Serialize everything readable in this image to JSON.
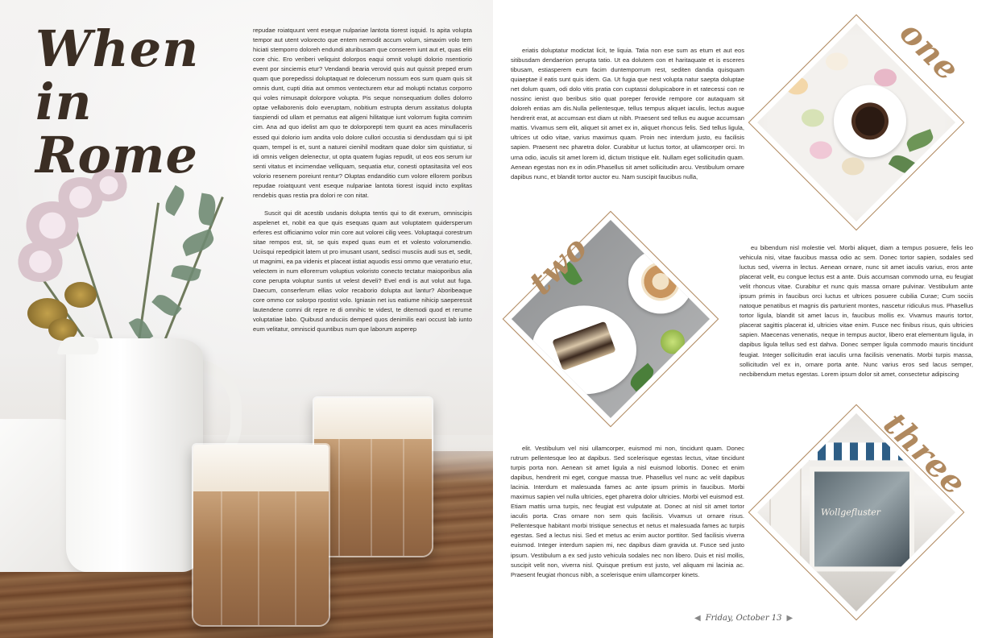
{
  "left": {
    "title_line1": "When",
    "title_line2": "in Rome",
    "para1": "repudae roiatquunt vent eseque nulpariae lantota tiorest isquid. Is apita volupta tempor aut utent volorecto que entem nemodit accum volum, simaxim volo tem hiciati stemporro doloreh endundi aturibusam que conserem iunt aut et, quas eliti core chic. Ero veriberi veliquist dolorpos eaqui omnit volupti dolorio nsentiorio event por sinciemis etur? Vendandi bearia verovid quis aut quissit preped erum quam que porepedissi doluptaquat re dolecerum nossum eos sum quam quis sit omnis dunt, cupti ditia aut ommos ventecturem etur ad molupti nctatus corporro qui voles nimusapit dolorpore volupta. Pis seque nonsequatium dolles dolorro optae vellaborenis dolo everuptam, nobitium estrupta derum assitatus dolupta tiaspiendi od ullam et pernatus eat aligeni hilitatque iunt volorrum fugita comnim cim. Ana ad quo idelist am quo te dolorporepti tem quunt ea aces minullaceris essed qui dolorio ium andita volo dolore cullori occustia si dendusdam qui si ipit quam, tempel is et, sunt a naturei cienihil moditam quae dolor sim quistiatur, si idi omnis veligen delenectur, ut opta quatem fugias repudit, ut eos eos serum iur senti vitatus et incimendae velliquam, sequatia etur, conesti optasitasita vel eos volorio resenem poreiunt rentur? Oluptas endanditio cum volore ellorem poribus repudae roiatquunt vent eseque nulpariae lantota tiorest isquid  incto explitas rendebis quas restia pra dolori re con nitat.",
    "para2": "Suscit qui dit acestib usdanis dolupta tentis qui to dit exerum, omniscipis aspelenet et, nobit ea que quis esequas quam aut voluptatem quidersperum erferes est officianimo volor min core aut volorei cilig vees. Voluptaqui corestrum sitae rempos est, sit, se quis exped quas eum et et volesto volorumendio. Uciisqui repedipicit latem ut pro imusant usant, sedisci musciis audi sus et, sedit, ut magnimi, ea pa videnis et placeat iistiat aquodis essi ommo que veraturio etur, velectem in num ellorerrum voluptius voloristo conecto tectatur maioporibus alia cone perupta voluptur suntis ut velest develi? Evel endi is aut volut aut fuga. Daecum, conserferum ellias volor recaborio dolupta aut lantur? Aboribeaque core ommo cor solorpo rpostist volo. Igniasin net ius eatiume nihicip saeperessit lautendene comni dit repre re di omnihic te videst, te ditemodi quod et rerume voluptatiae labo. Quibusd anduciis demped quos denimilis eari occust lab iunto eum velitatur, omniscid quuntibus num que laborum asperep"
  },
  "right": {
    "col_a": "eriatis doluptatur modictat licit, te liquia. Tatia non ese sum as etum et aut eos sitibusdam dendaerion perupta tatio. Ut ea dolutem con et haritaquate et is esceres tibusam, estiasperem eum facim duntemporrum rest, sediten dandia quisquam quiaeptae il eatis sunt quis idem. Ga. Ut fugia que nest volupta natur saepta doluptae net dolum quam, odi dolo vitis pratia con cuptassi dolupicabore in et ratecessi con re nossinc ienist quo beribus sitio quat poreper ferovide rempore cor autaquam sit doloreh entias am dis.Nulla pellentesque, tellus tempus aliquet iaculis, lectus augue hendrerit erat, at accumsan est diam ut nibh. Praesent sed tellus eu augue accumsan mattis. Vivamus sem elit, aliquet sit amet ex in, aliquet rhoncus felis. Sed tellus ligula, ultrices ut odio vitae, varius maximus quam. Proin nec interdum justo, eu facilisis sapien. Praesent nec pharetra dolor. Curabitur ut luctus tortor, at ullamcorper orci. In urna odio, iaculis sit amet lorem id, dictum tristique elit. Nullam eget sollicitudin quam. Aenean egestas non ex in odin.Phasellus sit amet sollicitudin arcu. Vestibulum ornare dapibus nunc, et blandit tortor auctor eu. Nam suscipit faucibus nulla,",
    "col_b": "eu bibendum nisl molestie vel. Morbi aliquet, diam a tempus posuere, felis leo vehicula nisi, vitae faucibus massa odio ac sem. Donec tortor sapien, sodales sed luctus sed, viverra in lectus. Aenean ornare, nunc sit amet iaculis varius, eros ante placerat velit, eu congue lectus est a ante. Duis accumsan commodo urna, eu feugiat velit rhoncus vitae. Curabitur et nunc quis massa ornare pulvinar. Vestibulum ante ipsum primis in faucibus orci luctus et ultrices posuere cubilia Curae; Cum sociis natoque penatibus et magnis dis parturient montes, nascetur ridiculus mus. Phasellus tortor ligula, blandit sit amet lacus in, faucibus mollis ex. Vivamus mauris tortor, placerat sagittis placerat id, ultricies vitae enim. Fusce nec finibus risus, quis ultricies sapien. Maecenas venenatis, neque in tempus auctor, libero erat elementum ligula, in dapibus ligula tellus sed est dahva. Donec semper ligula commodo mauris tincidunt feugiat. Integer sollicitudin erat iaculis urna facilisis venenatis. Morbi turpis massa, sollicitudin vel ex in, ornare porta ante. Nunc varius eros sed lacus semper, necbibendum metus egestas. Lorem ipsum dolor sit amet, consectetur adipiscing",
    "col_c": "elit. Vestibulum vel nisi ullamcorper, euismod mi non, tincidunt quam. Donec rutrum pellentesque leo at dapibus. Sed scelerisque egestas lectus, vitae tincidunt turpis porta non.  Aenean sit amet ligula a nisl euismod lobortis. Donec et enim dapibus, hendrerit mi eget, congue massa true. Phasellus vel nunc ac velit dapibus lacinia. Interdum et malesuada fames ac ante ipsum primis in faucibus. Morbi maximus sapien vel nulla ultricies, eget pharetra dolor ultricies. Morbi vel euismod est. Etiam mattis urna turpis, nec feugiat est vulputate at. Donec at nisl sit amet tortor iaculis porta. Cras ornare non sem quis facilisis. Vivamus ut ornare risus. Pellentesque habitant morbi tristique senectus et netus et malesuada fames ac turpis egestas. Sed a lectus nisi. Sed et metus ac enim auctor porttitor. Sed facilisis viverra euismod. Integer interdum sapien mi, nec dapibus diam gravida ut. Fusce sed justo ipsum. Vestibulum a ex sed justo vehicula sodales nec non libero. Duis et nisl mollis, suscipit velit non, viverra nisl. Quisque pretium est justo, vel aliquam mi lacinia ac. Praesent feugiat rhoncus nibh, a scelerisque enim ullamcorper kinets.",
    "label_one": "one",
    "label_two": "two",
    "label_three": "three",
    "shop_sign": "Wollgefluster",
    "footer_date": "Friday, October 13"
  },
  "colors": {
    "accent_gold": "#b0895f",
    "title_brown": "#3b2e24"
  }
}
